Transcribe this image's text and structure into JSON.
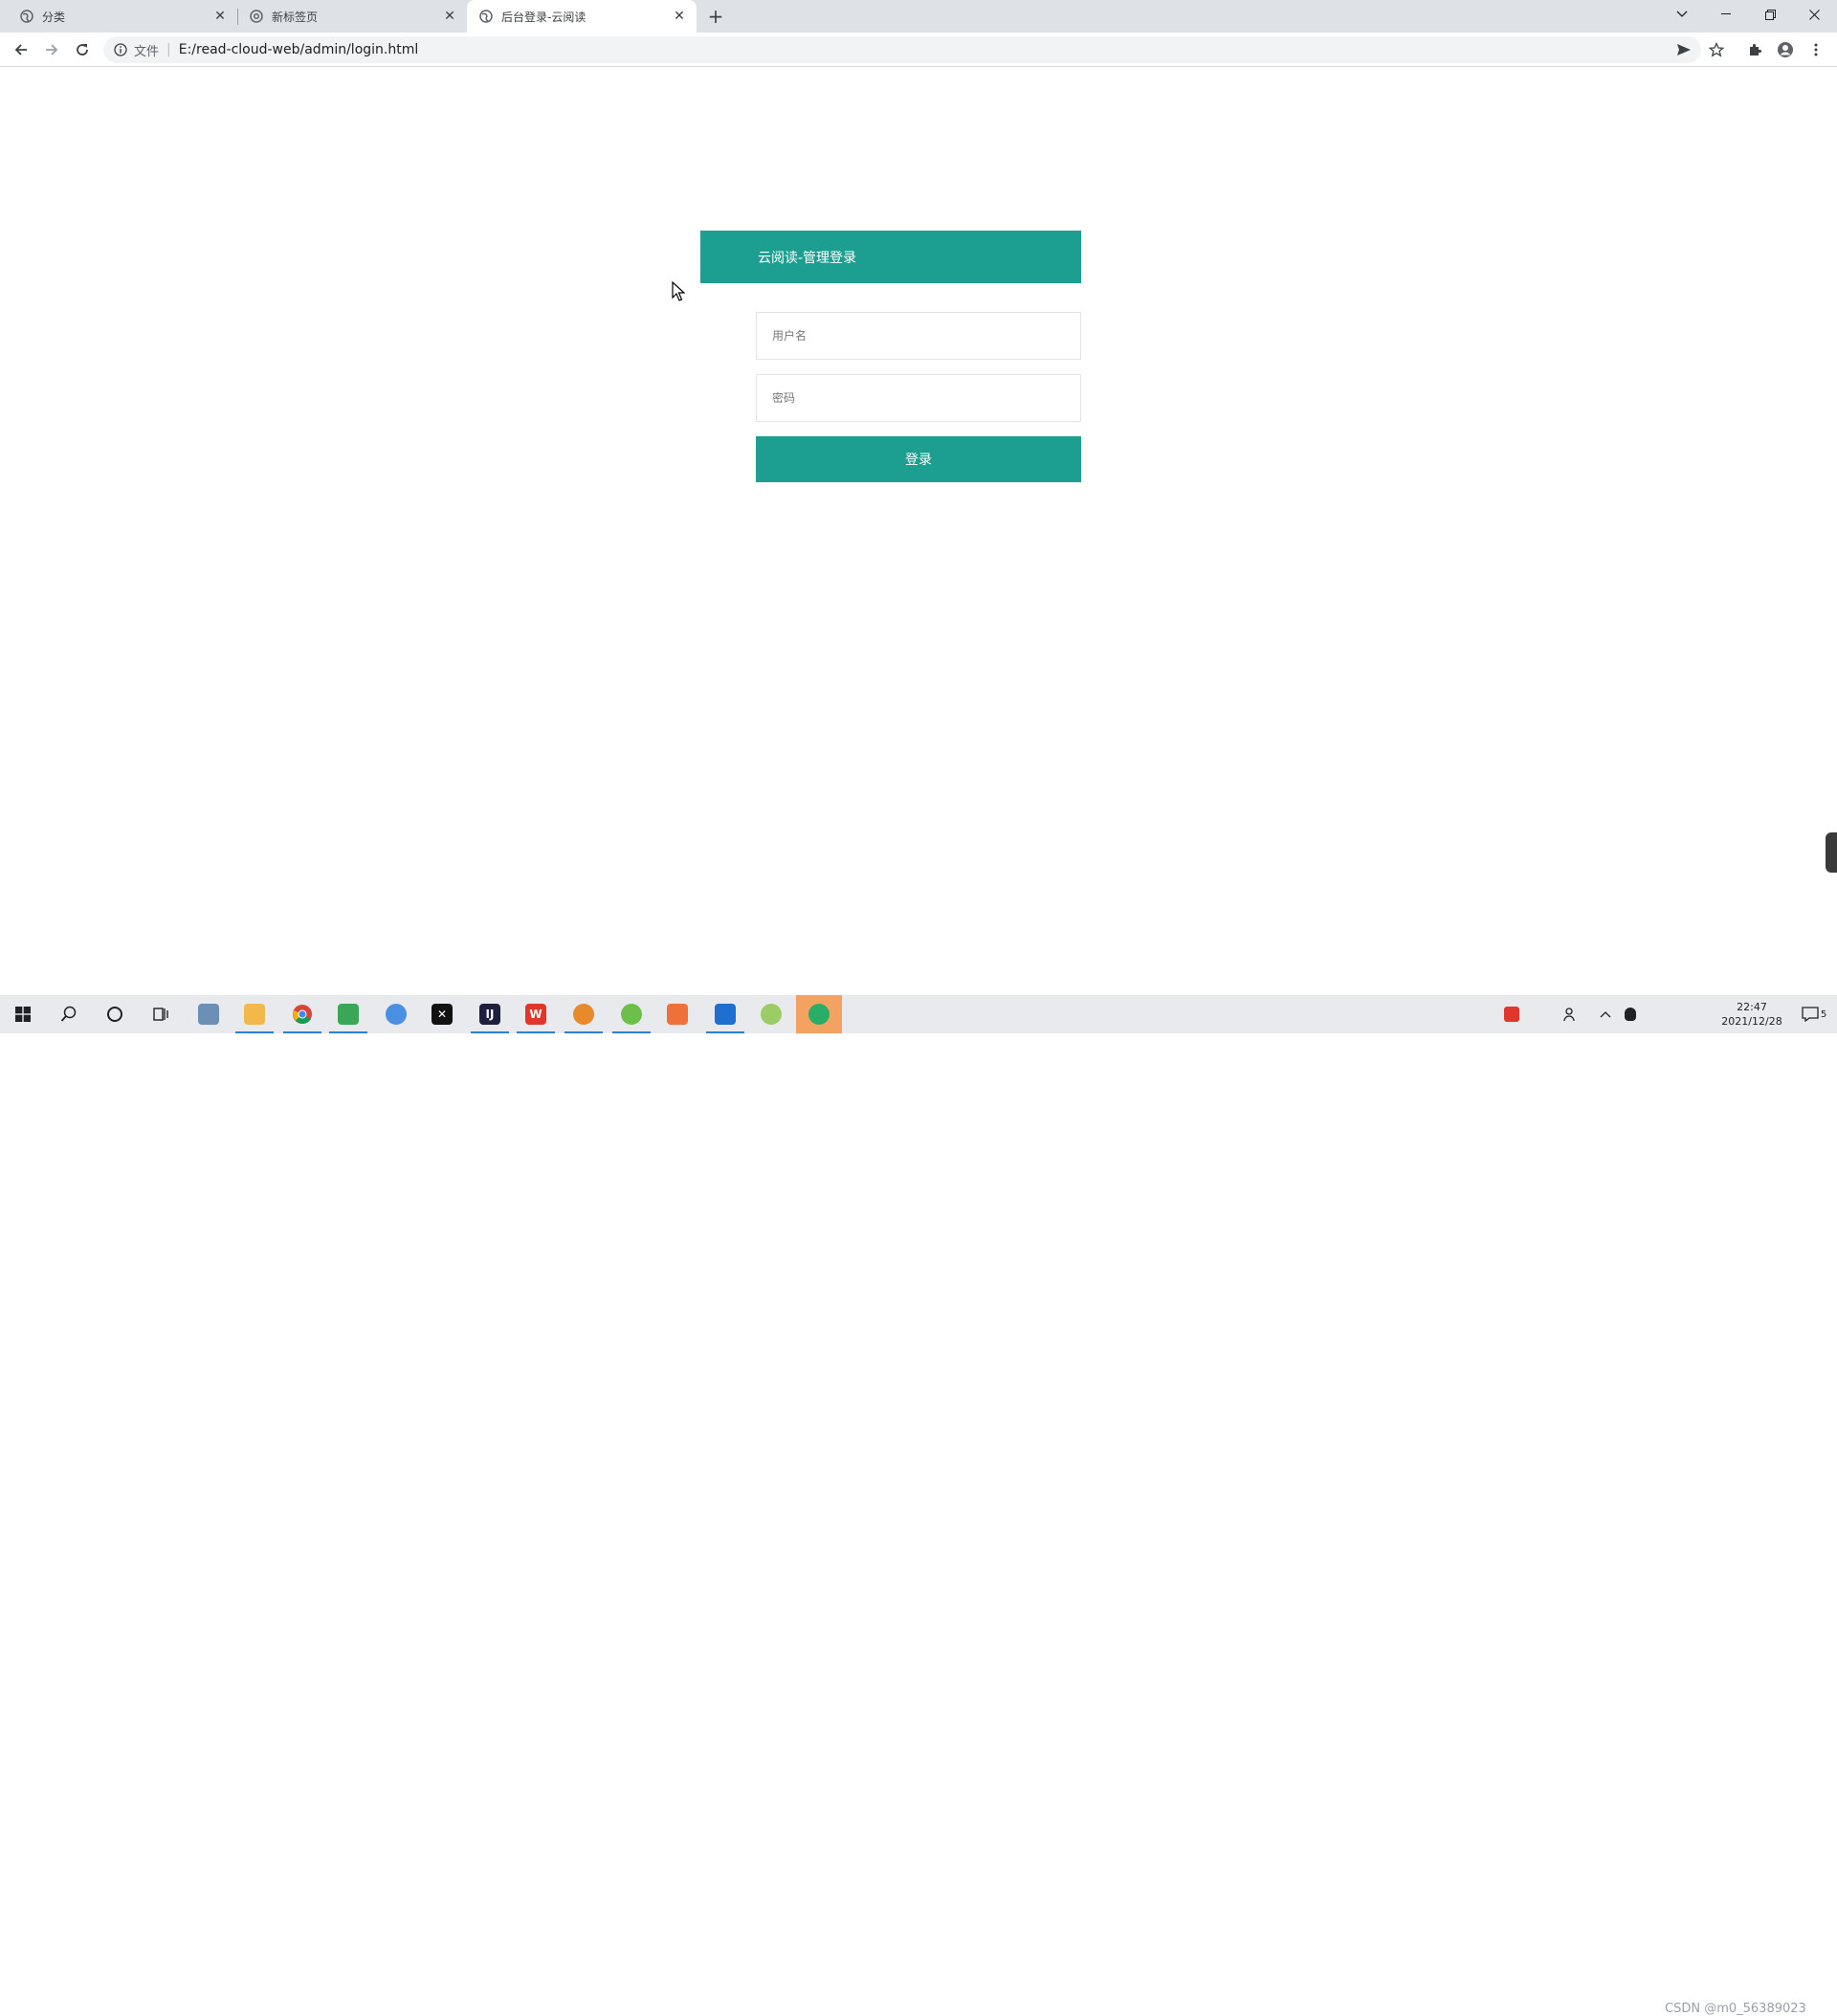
{
  "browser": {
    "tabs": [
      {
        "title": "分类",
        "active": false
      },
      {
        "title": "新标签页",
        "active": false
      },
      {
        "title": "后台登录-云阅读",
        "active": true
      }
    ],
    "new_tab_label": "+",
    "address": {
      "scheme_label": "文件",
      "divider": "|",
      "url": "E:/read-cloud-web/admin/login.html"
    }
  },
  "login": {
    "header_title": "云阅读-管理登录",
    "username_placeholder": "用户名",
    "password_placeholder": "密码",
    "submit_label": "登录"
  },
  "taskbar": {
    "apps": [
      {
        "name": "file-viewer",
        "color": "#6b8fb5"
      },
      {
        "name": "file-explorer",
        "color": "#f2b84b"
      },
      {
        "name": "chrome",
        "color": "#ffffff"
      },
      {
        "name": "notepad",
        "color": "#3aa757"
      },
      {
        "name": "network-app",
        "color": "#4a90e2"
      },
      {
        "name": "capcut",
        "color": "#111111"
      },
      {
        "name": "intellij",
        "color": "#1e1e3f"
      },
      {
        "name": "wps",
        "color": "#e0362c"
      },
      {
        "name": "search-tool",
        "color": "#e8892b"
      },
      {
        "name": "green-app",
        "color": "#6cc04a"
      },
      {
        "name": "orange-app",
        "color": "#f0703a"
      },
      {
        "name": "meeting-app",
        "color": "#1f6fd1"
      },
      {
        "name": "leaf-app",
        "color": "#9ccc65"
      },
      {
        "name": "wechat",
        "color": "#2aae67"
      }
    ],
    "clock_time": "22:47",
    "clock_date": "2021/12/28",
    "notification_count": "5",
    "watermark": "CSDN @m0_56389023"
  },
  "colors": {
    "accent": "#1c9f90",
    "tab_strip": "#dee1e6",
    "omnibox": "#f1f3f4"
  }
}
